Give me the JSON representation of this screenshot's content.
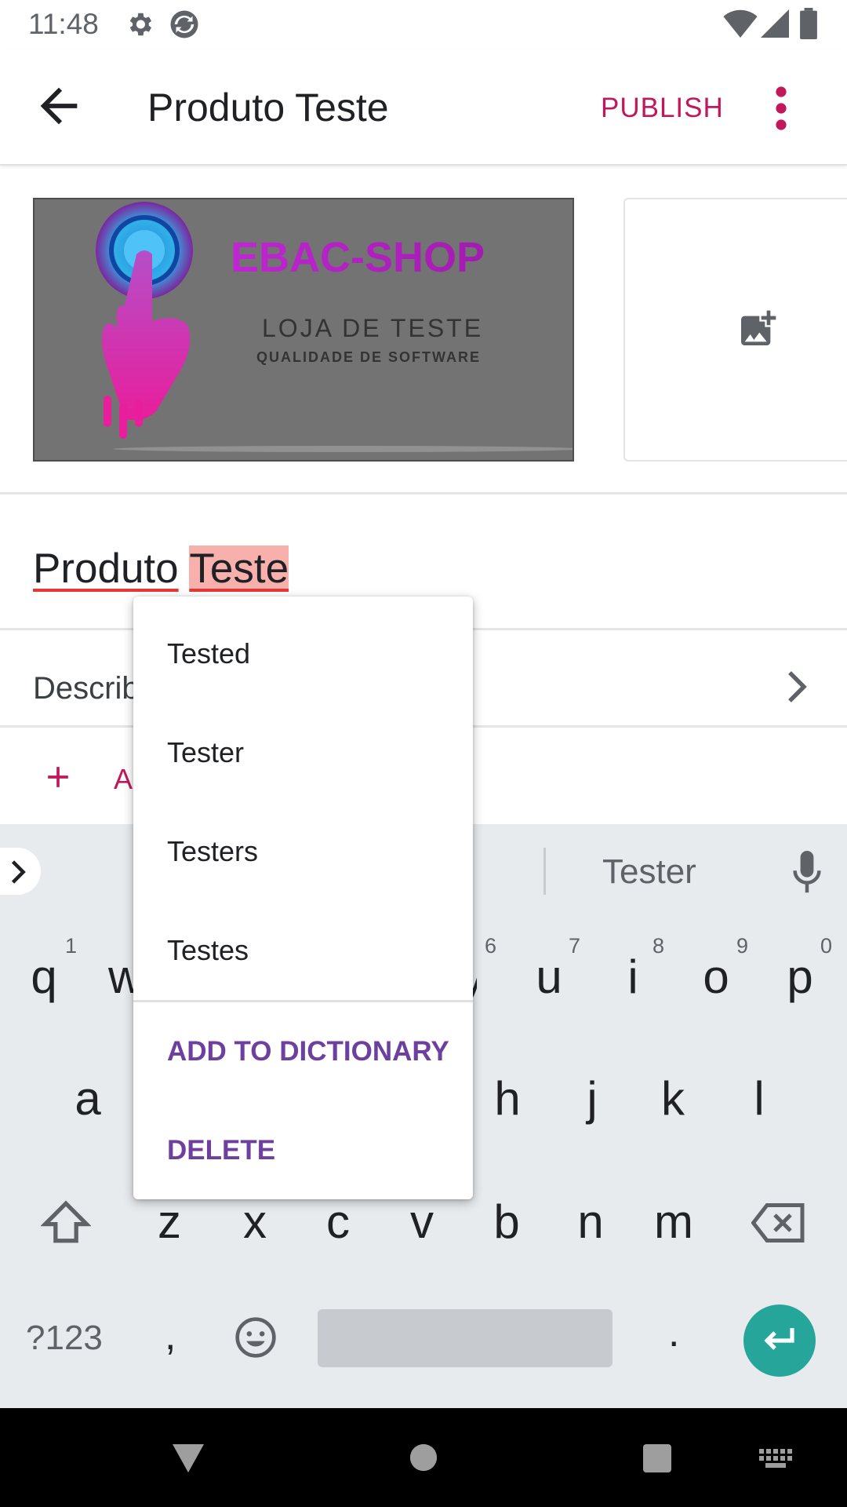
{
  "status_bar": {
    "time": "11:48"
  },
  "app_bar": {
    "title": "Produto Teste",
    "publish_label": "PUBLISH"
  },
  "image": {
    "logo_brand": "EBAC-SHOP",
    "logo_line1": "LOJA DE TESTE",
    "logo_line2": "QUALIDADE DE SOFTWARE"
  },
  "product_name": {
    "word1": "Produto",
    "word2": "Teste"
  },
  "description": {
    "label": "Describ"
  },
  "add_row": {
    "label": "A"
  },
  "spell_menu": {
    "suggestions": [
      "Tested",
      "Tester",
      "Testers",
      "Testes"
    ],
    "add_to_dictionary": "ADD TO DICTIONARY",
    "delete": "DELETE"
  },
  "keyboard": {
    "suggestion": "Tester",
    "row1": [
      "q",
      "w",
      "y",
      "u",
      "i",
      "o",
      "p"
    ],
    "row1_hints": [
      "1",
      "6",
      "7",
      "8",
      "9",
      "0"
    ],
    "row2": [
      "a",
      "h",
      "j",
      "k",
      "l"
    ],
    "row3": [
      "z",
      "x",
      "c",
      "v",
      "b",
      "n",
      "m"
    ],
    "symbols_label": "?123",
    "comma": ",",
    "period": "."
  }
}
